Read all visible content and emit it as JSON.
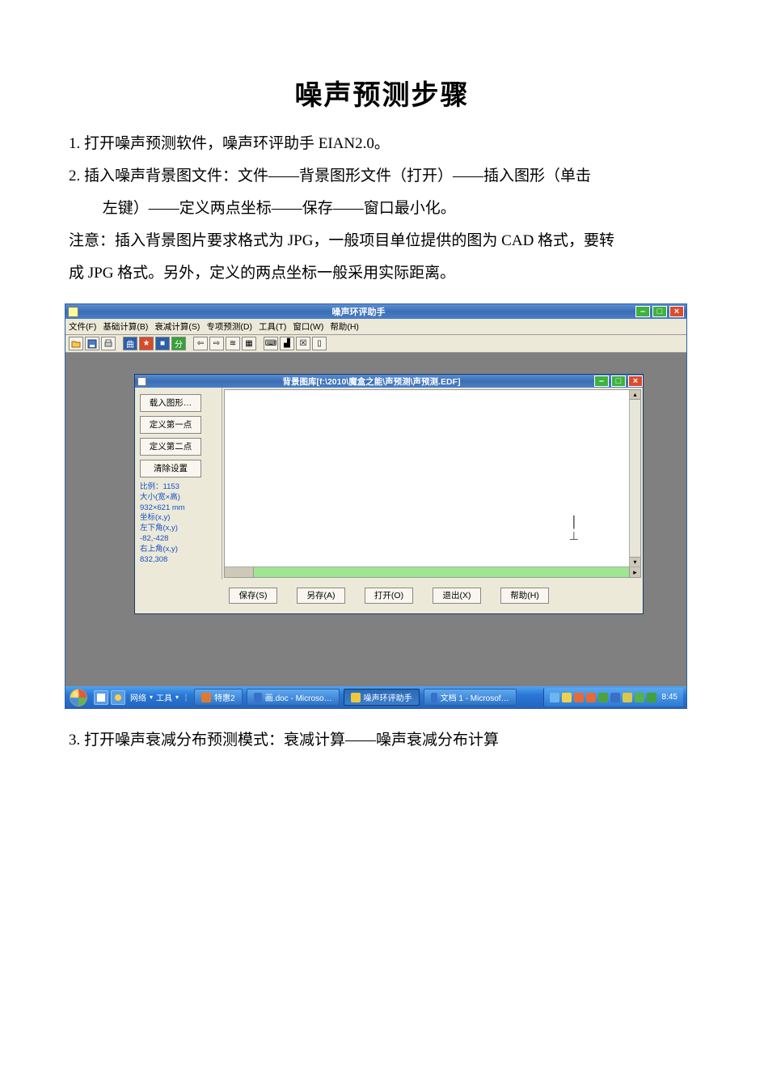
{
  "doc": {
    "title": "噪声预测步骤",
    "p1": "1. 打开噪声预测软件，噪声环评助手 EIAN2.0。",
    "p2": "2. 插入噪声背景图文件：文件——背景图形文件（打开）——插入图形（单击",
    "p2b": "左键）——定义两点坐标——保存——窗口最小化。",
    "note1": "注意：插入背景图片要求格式为 JPG，一般项目单位提供的图为 CAD 格式，要转",
    "note2": "成 JPG 格式。另外，定义的两点坐标一般采用实际距离。",
    "p3": "3. 打开噪声衰减分布预测模式：衰减计算——噪声衰减分布计算"
  },
  "app": {
    "title": "噪声环评助手",
    "menus": [
      "文件(F)",
      "基础计算(B)",
      "衰减计算(S)",
      "专项预测(D)",
      "工具(T)",
      "窗口(W)",
      "帮助(H)"
    ],
    "dialog": {
      "title": "背景图库[f:\\2010\\魔盒之能\\声预测\\声预测.EDF]",
      "side_buttons": [
        "载入图形…",
        "定义第一点",
        "定义第二点",
        "清除设置"
      ],
      "info_lines": [
        "比例：1153",
        "大小(宽×高)",
        "932×621 mm",
        "坐标(x,y)",
        "左下角(x,y)",
        "-82,-428",
        "右上角(x,y)",
        "832,308"
      ],
      "bottom_buttons": [
        "保存(S)",
        "另存(A)",
        "打开(O)",
        "退出(X)",
        "帮助(H)"
      ]
    }
  },
  "taskbar": {
    "mid_label": "网络",
    "mid_label2": "工具",
    "items": [
      "特惠2",
      "画.doc - Microso…",
      "噪声环评助手",
      "文档 1 - Microsof…"
    ],
    "time": "8:45"
  }
}
